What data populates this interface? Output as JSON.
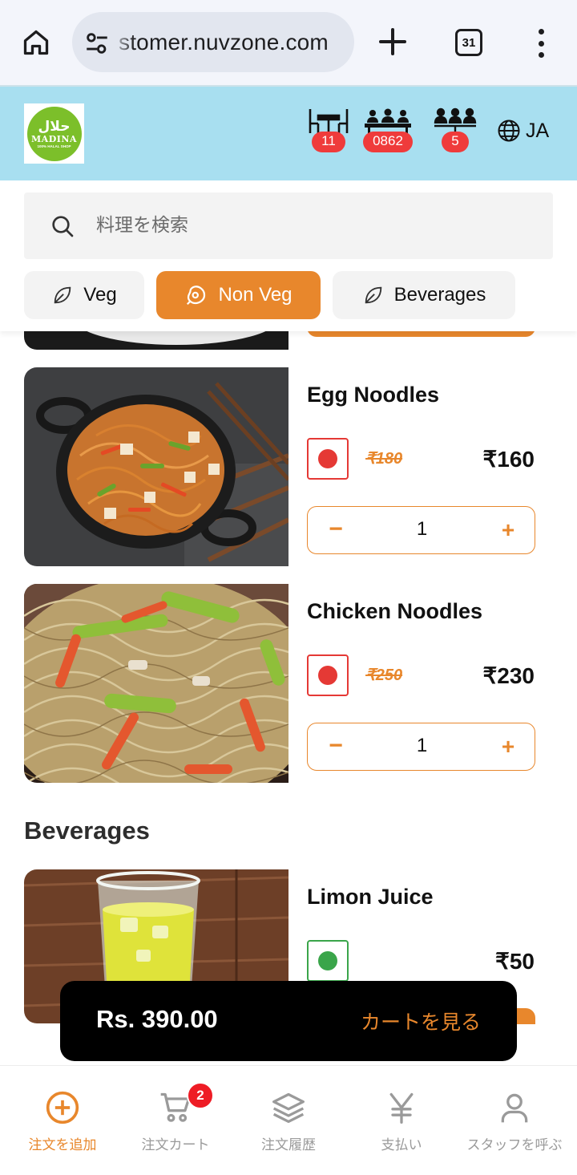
{
  "browser": {
    "url_fragment": "stomer.nuvzone.com",
    "tab_count": "31"
  },
  "header": {
    "logo": {
      "arabic": "حلال",
      "name": "MADINA",
      "tagline": "100% HALAL SHOP"
    },
    "table_number": "11",
    "order_code": "0862",
    "guest_count": "5",
    "language": "JA"
  },
  "search": {
    "placeholder": "料理を検索"
  },
  "categories": [
    {
      "label": "Veg",
      "active": false
    },
    {
      "label": "Non Veg",
      "active": true
    },
    {
      "label": "Beverages",
      "active": false
    }
  ],
  "items": [
    {
      "name": "Egg Noodles",
      "type": "non-veg",
      "old_price": "₹180",
      "price": "₹160",
      "qty": "1"
    },
    {
      "name": "Chicken Noodles",
      "type": "non-veg",
      "old_price": "₹250",
      "price": "₹230",
      "qty": "1"
    }
  ],
  "beverages_section": {
    "heading": "Beverages",
    "items": [
      {
        "name": "Limon Juice",
        "type": "veg",
        "price": "₹50"
      }
    ]
  },
  "cart": {
    "total": "Rs. 390.00",
    "view_label": "カートを見る"
  },
  "bottom_nav": [
    {
      "label": "注文を追加",
      "icon": "plus-circle-icon",
      "active": true
    },
    {
      "label": "注文カート",
      "icon": "cart-icon",
      "active": false,
      "badge": "2"
    },
    {
      "label": "注文履歴",
      "icon": "layers-icon",
      "active": false
    },
    {
      "label": "支払い",
      "icon": "yen-icon",
      "active": false
    },
    {
      "label": "スタッフを呼ぶ",
      "icon": "person-icon",
      "active": false
    }
  ],
  "colors": {
    "accent": "#e8872c",
    "header_bg": "#a8dff0",
    "nonveg": "#e53935",
    "veg": "#3aa54a",
    "badge": "#ef3b3b"
  }
}
